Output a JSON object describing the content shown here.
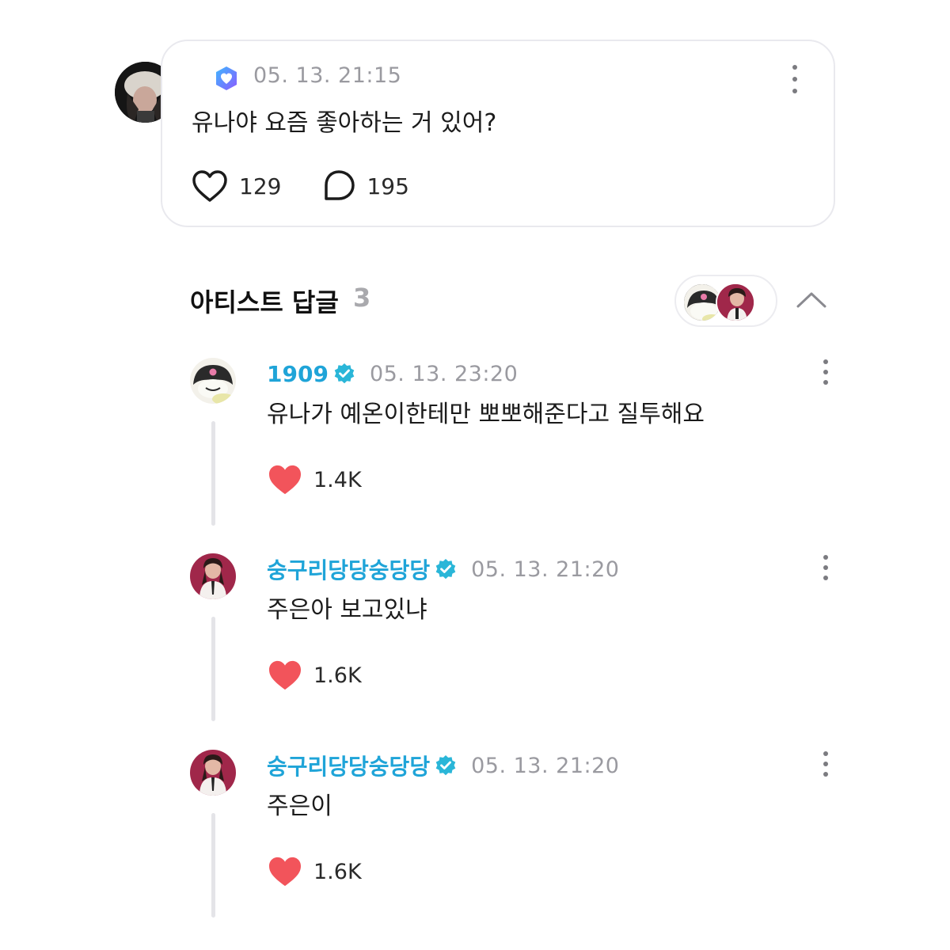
{
  "post": {
    "time": "05. 13. 21:15",
    "text": "유나야 요즘 좋아하는 거 있어?",
    "likes": "129",
    "comments": "195",
    "badge_icon": "heart-shield-icon"
  },
  "section": {
    "title": "아티스트 답글",
    "count": "3"
  },
  "replies": [
    {
      "name": "1909",
      "time": "05. 13. 23:20",
      "text": "유나가 예온이한테만 뽀뽀해준다고 질투해요",
      "likes": "1.4K"
    },
    {
      "name": "숭구리당당숭당당",
      "time": "05. 13. 21:20",
      "text": "주은아 보고있냐",
      "likes": "1.6K"
    },
    {
      "name": "숭구리당당숭당당",
      "time": "05. 13. 21:20",
      "text": "주은이",
      "likes": "1.6K"
    }
  ],
  "colors": {
    "artist_name": "#1fa4d8",
    "verified": "#2ab6d8",
    "like_filled": "#f2545b",
    "muted": "#9a9aa0"
  }
}
